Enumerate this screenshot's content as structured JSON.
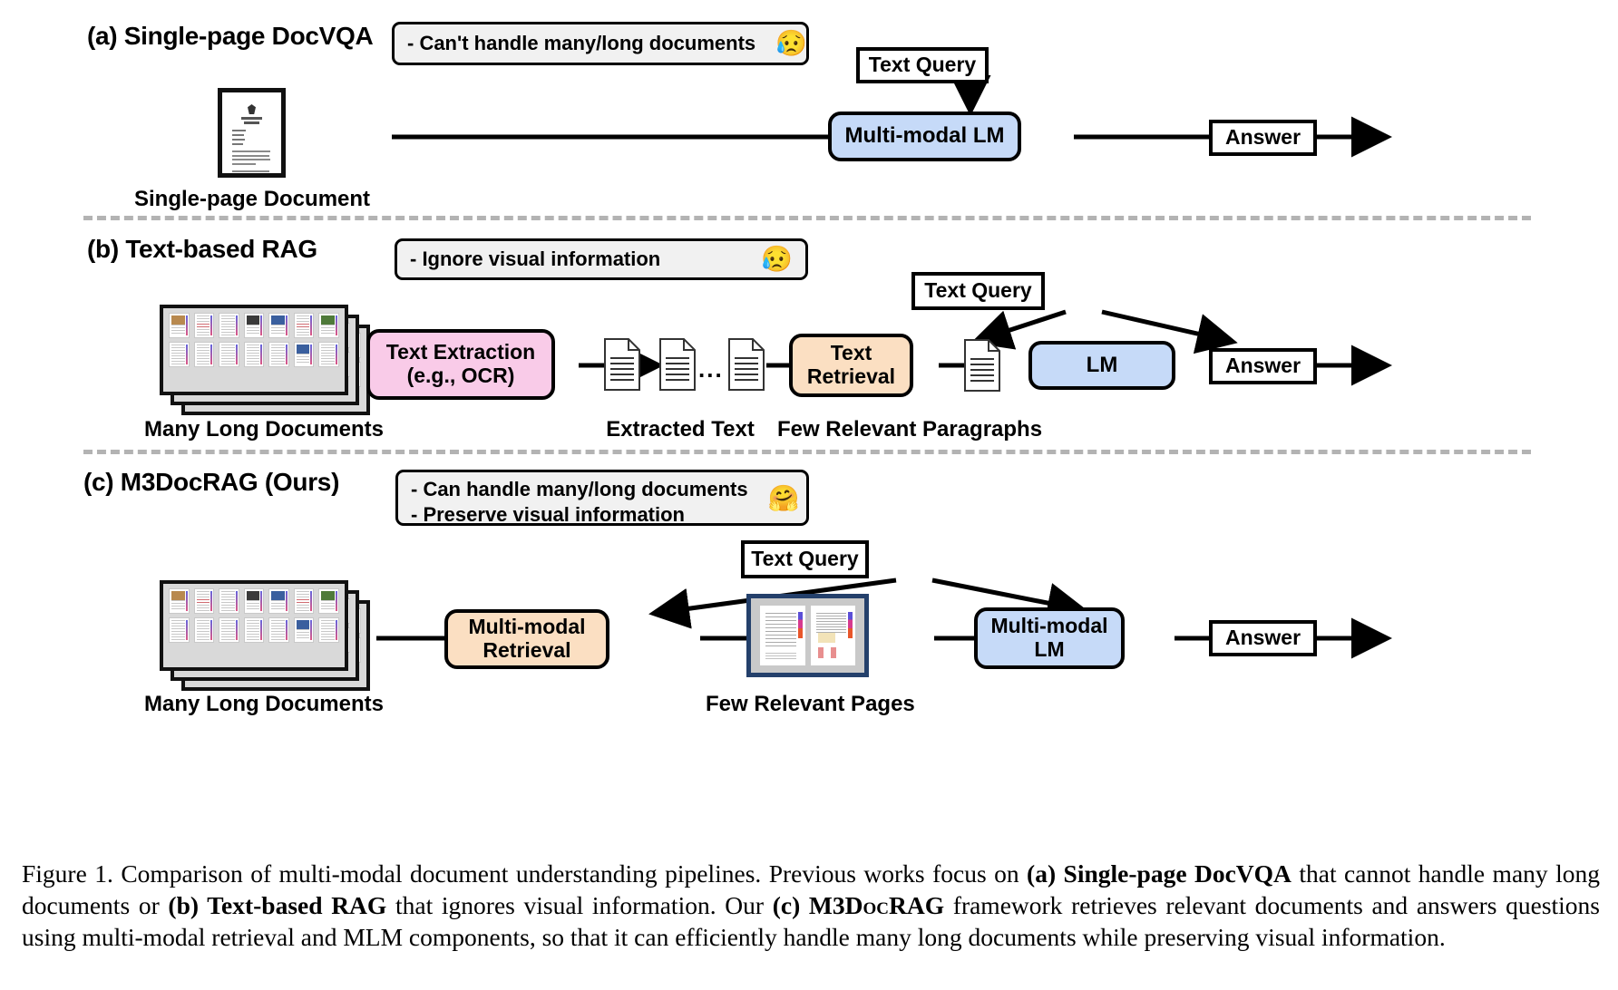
{
  "figure": {
    "sections": [
      {
        "id": "a",
        "title": "(a) Single-page DocVQA",
        "callout": {
          "lines": [
            "- Can't handle many/long documents"
          ],
          "emoji": "😥",
          "emoji_name": "sad-but-relieved-face"
        },
        "nodes": {
          "text_query": "Text Query",
          "model": "Multi-modal LM",
          "answer": "Answer"
        },
        "labels": {
          "doc": "Single-page Document"
        }
      },
      {
        "id": "b",
        "title": "(b) Text-based RAG",
        "callout": {
          "lines": [
            "- Ignore visual information"
          ],
          "emoji": "😥",
          "emoji_name": "sad-but-relieved-face"
        },
        "nodes": {
          "extraction": "Text Extraction\n(e.g., OCR)",
          "extraction_line1": "Text Extraction",
          "extraction_line2": "(e.g., OCR)",
          "text_query": "Text Query",
          "retrieval_line1": "Text",
          "retrieval_line2": "Retrieval",
          "model": "LM",
          "answer": "Answer"
        },
        "labels": {
          "docs": "Many Long Documents",
          "extracted": "Extracted Text",
          "paragraphs": "Few Relevant Paragraphs",
          "ellipsis": "..."
        }
      },
      {
        "id": "c",
        "title": "(c) M3DocRAG (Ours)",
        "callout": {
          "lines": [
            "- Can handle many/long documents",
            "- Preserve visual information"
          ],
          "emoji": "🤗",
          "emoji_name": "hugging-face"
        },
        "nodes": {
          "text_query": "Text Query",
          "retrieval_line1": "Multi-modal",
          "retrieval_line2": "Retrieval",
          "model_line1": "Multi-modal",
          "model_line2": "LM",
          "answer": "Answer"
        },
        "labels": {
          "docs": "Many Long Documents",
          "pages": "Few Relevant Pages"
        }
      }
    ],
    "caption": {
      "prefix": "Figure 1. Comparison of multi-modal document understanding pipelines. Previous works focus on ",
      "bold_a": "(a) Single-page DocVQA",
      "mid1": " that cannot handle many long documents or ",
      "bold_b": "(b) Text-based RAG",
      "mid2": " that ignores visual information. Our ",
      "bold_c_prefix": "(c) ",
      "bold_c": "M3DocRAG",
      "suffix": " framework retrieves relevant documents and answers questions using multi-modal retrieval and MLM components, so that it can efficiently handle many long documents while preserving visual information."
    },
    "colors": {
      "blue_node": "#c6daf8",
      "pink_node": "#f9cbe8",
      "peach_node": "#fbdfc2",
      "callout_bg": "#f1f1f1",
      "divider": "#b3b3b3",
      "spread_border": "#24406b",
      "stroke": "#000000"
    }
  }
}
